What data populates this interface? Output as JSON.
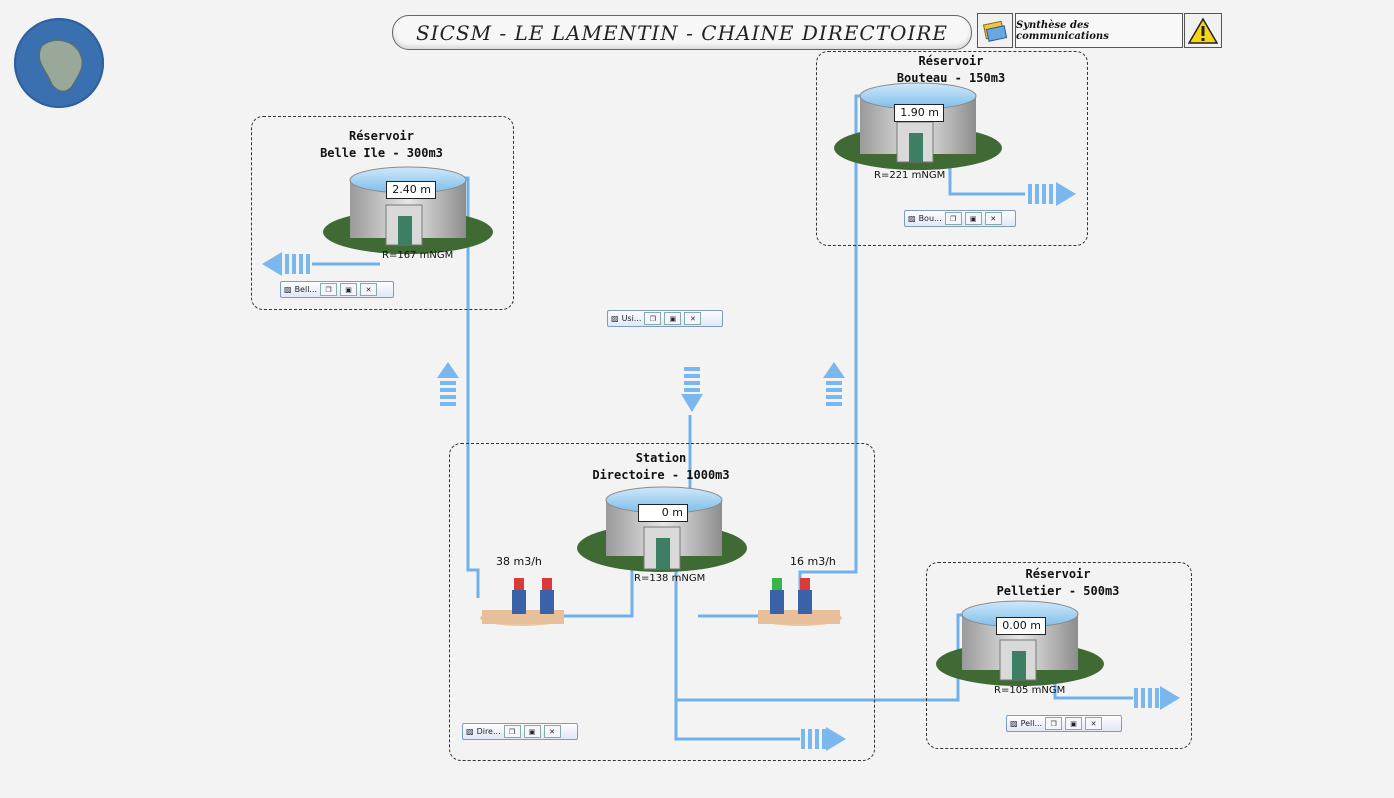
{
  "header": {
    "title": "SICSM - LE LAMENTIN - CHAINE DIRECTOIRE",
    "synthese_label": "Synthèse des communications"
  },
  "icons": {
    "logo": "martinique-map-logo",
    "book": "book-icon",
    "warning": "warning-icon"
  },
  "colors": {
    "pipe": "#6fb1ea",
    "arrow": "#79b7ee",
    "water": "#8fc8ee",
    "grass": "#3f6a33"
  },
  "reservoirs": {
    "belle_ile": {
      "title_line1": "Réservoir",
      "title_line2": "Belle Ile - 300m3",
      "level": "2.40 m",
      "r_label": "R=167 mNGM",
      "mini_label": "Bell..."
    },
    "bouteau": {
      "title_line1": "Réservoir",
      "title_line2": "Bouteau - 150m3",
      "level": "1.90 m",
      "r_label": "R=221 mNGM",
      "mini_label": "Bou..."
    },
    "pelletier": {
      "title_line1": "Réservoir",
      "title_line2": "Pelletier - 500m3",
      "level": "0.00 m",
      "r_label": "R=105 mNGM",
      "mini_label": "Pell..."
    }
  },
  "station": {
    "title_line1": "Station",
    "title_line2": "Directoire - 1000m3",
    "level": "0 m",
    "r_label": "R=138 mNGM",
    "flow_left": "38 m3/h",
    "flow_right": "16 m3/h",
    "mini_label": "Dire..."
  },
  "usine_mini_label": "Usi..."
}
